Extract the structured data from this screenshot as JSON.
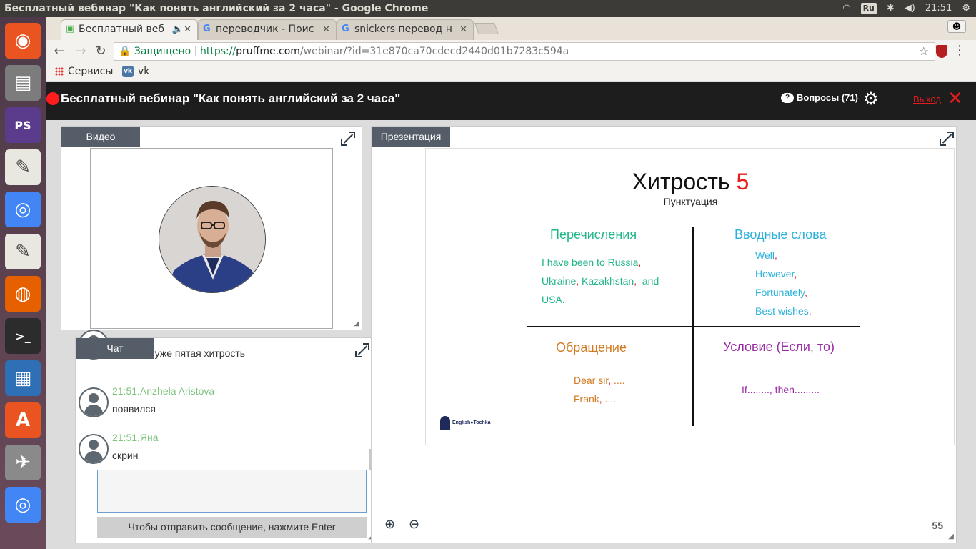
{
  "system": {
    "window_title": "Бесплатный вебинар \"Как понять английский за 2 часа\" - Google Chrome",
    "keyboard_layout": "Ru",
    "clock": "21:51"
  },
  "launcher": {
    "items": [
      {
        "name": "ubuntu-dash",
        "glyph": "◉",
        "color": "#e95420"
      },
      {
        "name": "files",
        "glyph": "▤",
        "color": "#7c7c7c"
      },
      {
        "name": "phpstorm",
        "glyph": "PS",
        "color": "#5b3b8c"
      },
      {
        "name": "text-editor",
        "glyph": "✎",
        "color": "#e8e8e0"
      },
      {
        "name": "chrome",
        "glyph": "◎",
        "color": "#4285f4"
      },
      {
        "name": "text-editor-2",
        "glyph": "✎",
        "color": "#e8e8e0"
      },
      {
        "name": "firefox",
        "glyph": "◍",
        "color": "#e66000"
      },
      {
        "name": "terminal",
        "glyph": ">_",
        "color": "#2c2c2c"
      },
      {
        "name": "writer",
        "glyph": "▦",
        "color": "#2f6fb5"
      },
      {
        "name": "software-center",
        "glyph": "A",
        "color": "#e95420"
      },
      {
        "name": "tool",
        "glyph": "✈",
        "color": "#8a8a8a"
      },
      {
        "name": "chrome-2",
        "glyph": "◎",
        "color": "#4285f4"
      }
    ]
  },
  "browser": {
    "tabs": [
      {
        "label": "Бесплатный веб",
        "active": true
      },
      {
        "label": "переводчик - Поис",
        "active": false
      },
      {
        "label": "snickers перевод н",
        "active": false
      }
    ],
    "url": {
      "secure_label": "Защищено",
      "protocol": "https://",
      "host": "pruffme.com",
      "path": "/webinar/?id=31e870ca70cdecd2440d01b7283c594a"
    },
    "bookmarks": [
      {
        "label": "Сервисы"
      },
      {
        "label": "vk"
      }
    ]
  },
  "webinar": {
    "title": "Бесплатный вебинар \"Как понять английский за 2 часа\"",
    "questions_label": "Вопросы (71)",
    "exit_label": "Выход",
    "video_tab": "Видео",
    "chat_tab": "Чат",
    "presentation_tab": "Презентация",
    "chat": {
      "messages": [
        {
          "meta": "",
          "text": "да, идет, уже пятая хитрость"
        },
        {
          "meta": "21:51,Anzhela Aristova",
          "text": "появился"
        },
        {
          "meta": "21:51,Яна",
          "text": "скрин"
        }
      ],
      "send_hint": "Чтобы отправить сообщение, нажмите Enter"
    },
    "slide": {
      "title_text": "Хитрость",
      "title_number": "5",
      "subtitle": "Пунктуация",
      "q1_title": "Перечисления",
      "q1_lines": [
        "I have been to Russia",
        "Ukraine",
        "Kazakhstan",
        "and",
        "USA"
      ],
      "q2_title": "Вводные слова",
      "q2_lines": [
        "Well",
        "However",
        "Fortunately",
        "Best wishes"
      ],
      "q3_title": "Обращение",
      "q3_lines": [
        "Dear sir",
        "....",
        "Frank",
        "...."
      ],
      "q4_title": "Условие (Если, то)",
      "q4_line": "If........, then.........",
      "logo_text": "English●Tochka",
      "colors": {
        "green": "#21b58a",
        "blue": "#2bb1da",
        "orange": "#d27a20",
        "purple": "#9b2aa6",
        "red": "#e81c1c"
      }
    },
    "page_number": "55"
  }
}
